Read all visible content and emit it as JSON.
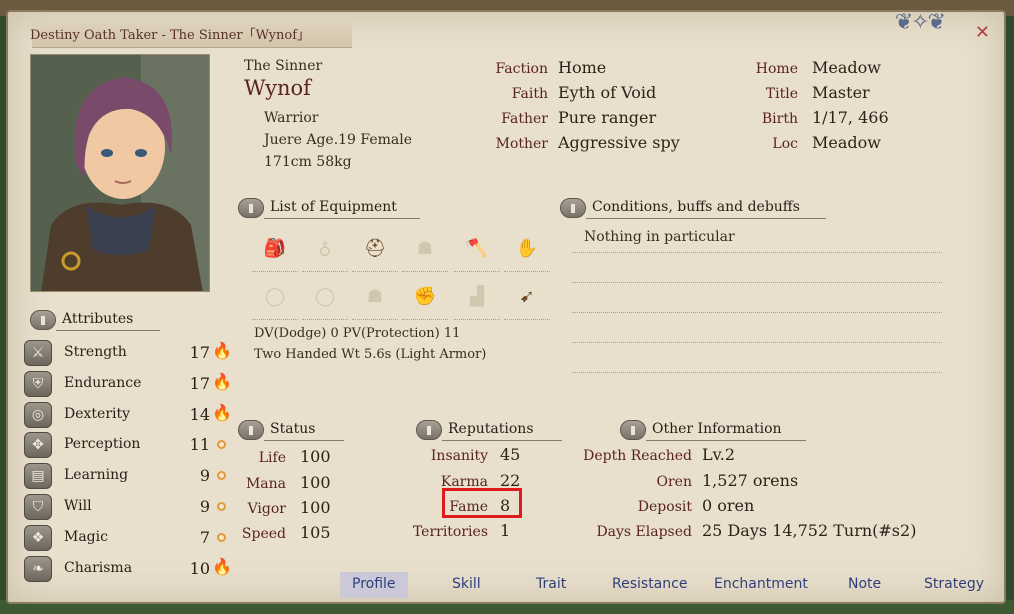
{
  "window": {
    "title": "Destiny Oath Taker - The Sinner「Wynof」"
  },
  "character": {
    "alias": "The Sinner",
    "name": "Wynof",
    "class": "Warrior",
    "race_age_sex": "Juere Age.19 Female",
    "height_weight": "171cm 58kg"
  },
  "info_mid": [
    {
      "label": "Faction",
      "value": "Home"
    },
    {
      "label": "Faith",
      "value": "Eyth of Void"
    },
    {
      "label": "Father",
      "value": "Pure ranger"
    },
    {
      "label": "Mother",
      "value": "Aggressive spy"
    }
  ],
  "info_right": [
    {
      "label": "Home",
      "value": "Meadow"
    },
    {
      "label": "Title",
      "value": "Master"
    },
    {
      "label": "Birth",
      "value": "1/17, 466"
    },
    {
      "label": "Loc",
      "value": "Meadow"
    }
  ],
  "equipment": {
    "heading": "List of Equipment",
    "slots_row1": [
      "backpack-icon",
      "amulet-icon",
      "helmet-icon",
      "cloak-icon",
      "axe-icon",
      "glove-icon"
    ],
    "slots_row2": [
      "ring-icon",
      "ring-icon",
      "armor-icon",
      "gauntlet-icon",
      "boots-icon",
      "ammo-icon"
    ],
    "dv_pv": "DV(Dodge) 0   PV(Protection) 11",
    "weight": "Two Handed Wt 5.6s (Light Armor)"
  },
  "conditions": {
    "heading": "Conditions, buffs and debuffs",
    "text": "Nothing in particular"
  },
  "attributes": {
    "heading": "Attributes",
    "items": [
      {
        "name": "Strength",
        "value": "17",
        "potential": "flame",
        "icon": "swords-icon"
      },
      {
        "name": "Endurance",
        "value": "17",
        "potential": "flame",
        "icon": "armor-icon"
      },
      {
        "name": "Dexterity",
        "value": "14",
        "potential": "flame",
        "icon": "dexterity-icon"
      },
      {
        "name": "Perception",
        "value": "11",
        "potential": "dot",
        "icon": "perception-icon"
      },
      {
        "name": "Learning",
        "value": "9",
        "potential": "dot",
        "icon": "book-icon"
      },
      {
        "name": "Will",
        "value": "9",
        "potential": "dot",
        "icon": "shield-icon"
      },
      {
        "name": "Magic",
        "value": "7",
        "potential": "dot",
        "icon": "magic-icon"
      },
      {
        "name": "Charisma",
        "value": "10",
        "potential": "flame",
        "icon": "ribbon-icon"
      }
    ]
  },
  "status": {
    "heading": "Status",
    "items": [
      {
        "label": "Life",
        "value": "100"
      },
      {
        "label": "Mana",
        "value": "100"
      },
      {
        "label": "Vigor",
        "value": "100"
      },
      {
        "label": "Speed",
        "value": "105"
      }
    ]
  },
  "reputations": {
    "heading": "Reputations",
    "items": [
      {
        "label": "Insanity",
        "value": "45"
      },
      {
        "label": "Karma",
        "value": "22"
      },
      {
        "label": "Fame",
        "value": "8"
      },
      {
        "label": "Territories",
        "value": "1"
      }
    ]
  },
  "other": {
    "heading": "Other Information",
    "items": [
      {
        "label": "Depth Reached",
        "value": "Lv.2"
      },
      {
        "label": "Oren",
        "value": "1,527  orens"
      },
      {
        "label": "Deposit",
        "value": "0  oren"
      },
      {
        "label": "Days Elapsed",
        "value": "25 Days 14,752 Turn(#s2)"
      }
    ]
  },
  "tabs": [
    "Profile",
    "Skill",
    "Trait",
    "Resistance",
    "Enchantment",
    "Note",
    "Strategy"
  ],
  "active_tab": "Profile",
  "colors": {
    "highlight": "#e01a1a",
    "tab_text": "#2f3f7a",
    "label_red": "#5a2222"
  }
}
